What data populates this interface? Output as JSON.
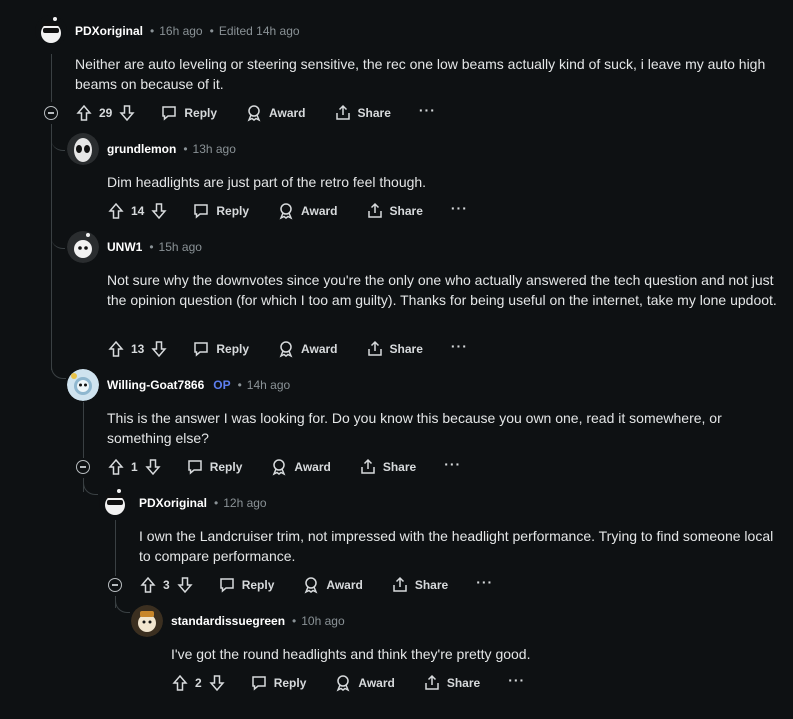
{
  "comments": [
    {
      "author": "PDXoriginal",
      "op": "",
      "time": "16h ago",
      "edited": "Edited 14h ago",
      "body": "Neither are auto leveling or steering sensitive, the rec one low beams actually kind of suck, i leave my auto high beams on because of it.",
      "votes": "29",
      "reply": "Reply",
      "award": "Award",
      "share": "Share",
      "more": "···"
    },
    {
      "author": "grundlemon",
      "time": "13h ago",
      "body": "Dim headlights are just part of the retro feel though.",
      "votes": "14",
      "reply": "Reply",
      "award": "Award",
      "share": "Share",
      "more": "···"
    },
    {
      "author": "UNW1",
      "time": "15h ago",
      "body": "Not sure why the downvotes since you're the only one who actually answered the tech question and not just the opinion question (for which I too am guilty). Thanks for being useful on the internet, take my lone updoot.",
      "votes": "13",
      "reply": "Reply",
      "award": "Award",
      "share": "Share",
      "more": "···"
    },
    {
      "author": "Willing-Goat7866",
      "op": "OP",
      "time": "14h ago",
      "body": "This is the answer I was looking for. Do you know this because you own one, read it somewhere, or something else?",
      "votes": "1",
      "reply": "Reply",
      "award": "Award",
      "share": "Share",
      "more": "···"
    },
    {
      "author": "PDXoriginal",
      "time": "12h ago",
      "body": "I own the Landcruiser trim, not impressed with the headlight performance. Trying to find someone local to compare performance.",
      "votes": "3",
      "reply": "Reply",
      "award": "Award",
      "share": "Share",
      "more": "···"
    },
    {
      "author": "standardissuegreen",
      "time": "10h ago",
      "body": "I've got the round headlights and think they're pretty good.",
      "votes": "2",
      "reply": "Reply",
      "award": "Award",
      "share": "Share",
      "more": "···"
    }
  ],
  "colors": {
    "background": "#0e1113",
    "op_badge": "#5e7ff0",
    "muted": "#8a9296"
  }
}
